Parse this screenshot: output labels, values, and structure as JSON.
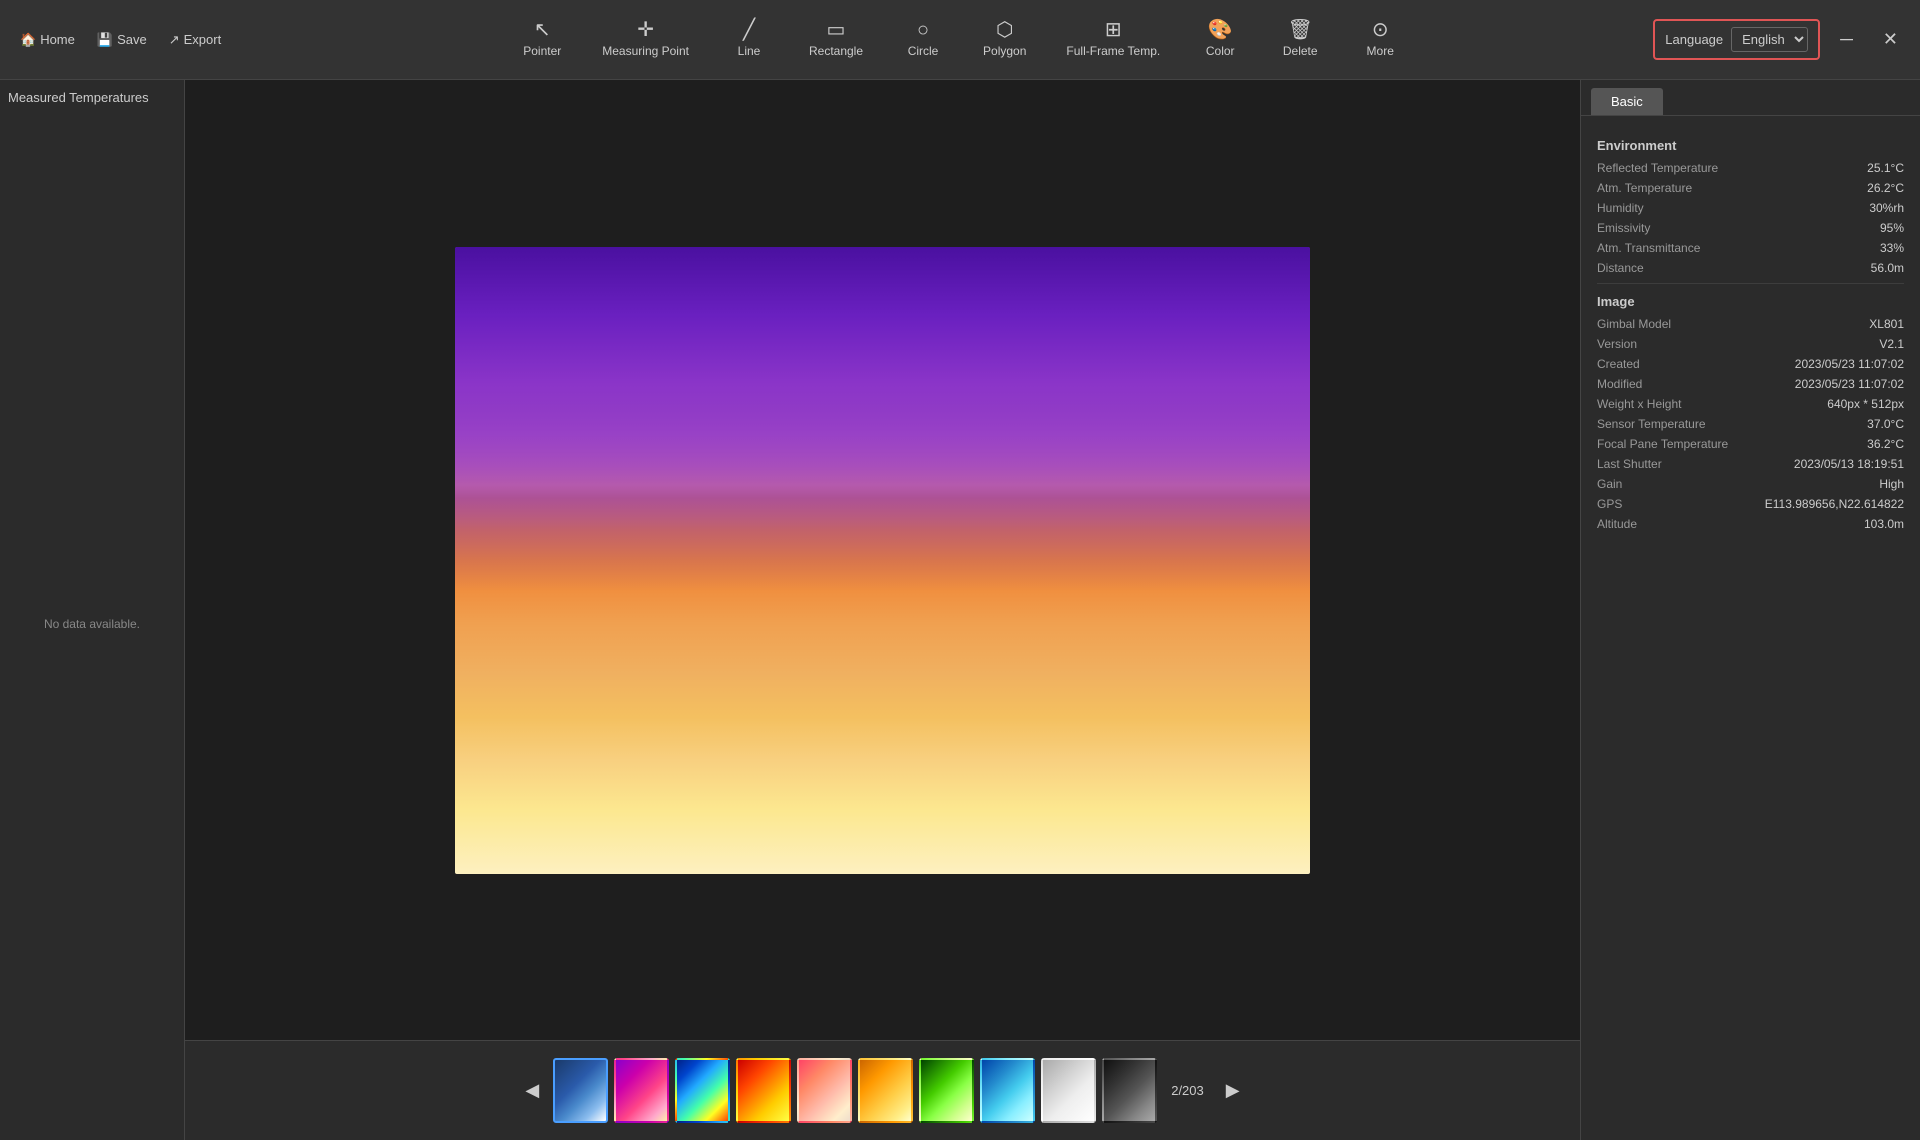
{
  "toolbar": {
    "home_label": "Home",
    "save_label": "Save",
    "export_label": "Export",
    "tools": [
      {
        "id": "pointer",
        "label": "Pointer",
        "icon": "↖"
      },
      {
        "id": "measuring-point",
        "label": "Measuring\nPoint",
        "icon": "✛"
      },
      {
        "id": "line",
        "label": "Line",
        "icon": "╱"
      },
      {
        "id": "rectangle",
        "label": "Rectangle",
        "icon": "▭"
      },
      {
        "id": "circle",
        "label": "Circle",
        "icon": "○"
      },
      {
        "id": "polygon",
        "label": "Polygon",
        "icon": "⬡"
      },
      {
        "id": "full-frame",
        "label": "Full-Frame\nTemp.",
        "icon": "⊞"
      },
      {
        "id": "color",
        "label": "Color",
        "icon": "🎨"
      },
      {
        "id": "delete",
        "label": "Delete",
        "icon": "🗑"
      },
      {
        "id": "more",
        "label": "More",
        "icon": "⊙"
      }
    ],
    "language_label": "Language",
    "language_value": "English"
  },
  "left_panel": {
    "title": "Measured Temperatures",
    "no_data": "No data available."
  },
  "thumbnail_bar": {
    "page_current": "2",
    "page_total": "203",
    "page_text": "2/203"
  },
  "right_panel": {
    "tab_basic": "Basic",
    "sections": {
      "environment": {
        "title": "Environment",
        "rows": [
          {
            "label": "Reflected Temperature",
            "value": "25.1°C"
          },
          {
            "label": "Atm. Temperature",
            "value": "26.2°C"
          },
          {
            "label": "Humidity",
            "value": "30%rh"
          },
          {
            "label": "Emissivity",
            "value": "95%"
          },
          {
            "label": "Atm. Transmittance",
            "value": "33%"
          },
          {
            "label": "Distance",
            "value": "56.0m"
          }
        ]
      },
      "image": {
        "title": "Image",
        "rows": [
          {
            "label": "Gimbal Model",
            "value": "XL801"
          },
          {
            "label": "Version",
            "value": "V2.1"
          },
          {
            "label": "Created",
            "value": "2023/05/23 11:07:02"
          },
          {
            "label": "Modified",
            "value": "2023/05/23 11:07:02"
          },
          {
            "label": "Weight x Height",
            "value": "640px * 512px"
          },
          {
            "label": "Sensor Temperature",
            "value": "37.0°C"
          },
          {
            "label": "Focal Pane Temperature",
            "value": "36.2°C"
          },
          {
            "label": "Last Shutter",
            "value": "2023/05/13 18:19:51"
          },
          {
            "label": "Gain",
            "value": "High"
          },
          {
            "label": "GPS",
            "value": "E113.989656,N22.614822"
          },
          {
            "label": "Altitude",
            "value": "103.0m"
          }
        ]
      }
    }
  }
}
